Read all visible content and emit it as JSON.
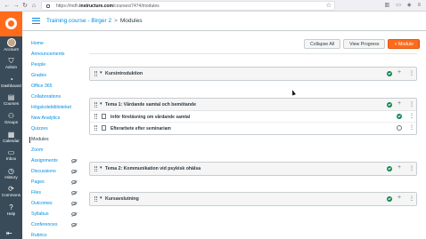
{
  "browser": {
    "url_prefix": "https://mdh.",
    "url_domain": "instructure.com",
    "url_path": "/courses/7474/modules"
  },
  "global_nav": {
    "items": [
      {
        "label": "Account"
      },
      {
        "label": "Admin"
      },
      {
        "label": "Dashboard"
      },
      {
        "label": "Courses"
      },
      {
        "label": "Groups"
      },
      {
        "label": "Calendar"
      },
      {
        "label": "Inbox"
      },
      {
        "label": "History"
      },
      {
        "label": "Commons"
      },
      {
        "label": "Help"
      }
    ]
  },
  "header": {
    "course_link": "Training course - Birger 2",
    "separator": ">",
    "current_page": "Modules"
  },
  "course_nav": {
    "items": [
      {
        "label": "Home"
      },
      {
        "label": "Announcements"
      },
      {
        "label": "People"
      },
      {
        "label": "Grades"
      },
      {
        "label": "Office 365"
      },
      {
        "label": "Collaborations"
      },
      {
        "label": "Högskolebiblioteket"
      },
      {
        "label": "New Analytics"
      },
      {
        "label": "Quizzes"
      },
      {
        "label": "Modules"
      },
      {
        "label": "Zoom"
      },
      {
        "label": "Assignments"
      },
      {
        "label": "Discussions"
      },
      {
        "label": "Pages"
      },
      {
        "label": "Files"
      },
      {
        "label": "Outcomes"
      },
      {
        "label": "Syllabus"
      },
      {
        "label": "Conferences"
      },
      {
        "label": "Rubrics"
      }
    ]
  },
  "toolbar": {
    "collapse_all": "Collapse All",
    "view_progress": "View Progress",
    "add_module": "+ Module",
    "kebab": "⋮"
  },
  "modules": [
    {
      "title": "Kursintroduktion",
      "published": true,
      "items": []
    },
    {
      "title": "Tema 1: Vårdande samtal och bemötande",
      "published": true,
      "items": [
        {
          "title": "Inför föreläsning om vårdande samtal",
          "published": true
        },
        {
          "title": "Efterarbete efter seminariam",
          "published": false
        }
      ]
    },
    {
      "title": "Tema 2: Kommunikation vid psykisk ohälsa",
      "published": true,
      "items": []
    },
    {
      "title": "Kursavslutning",
      "published": true,
      "items": []
    }
  ],
  "colors": {
    "accent": "#ff6b1b",
    "nav_bg": "#394b58",
    "link": "#008ee2",
    "published": "#0b874b"
  }
}
